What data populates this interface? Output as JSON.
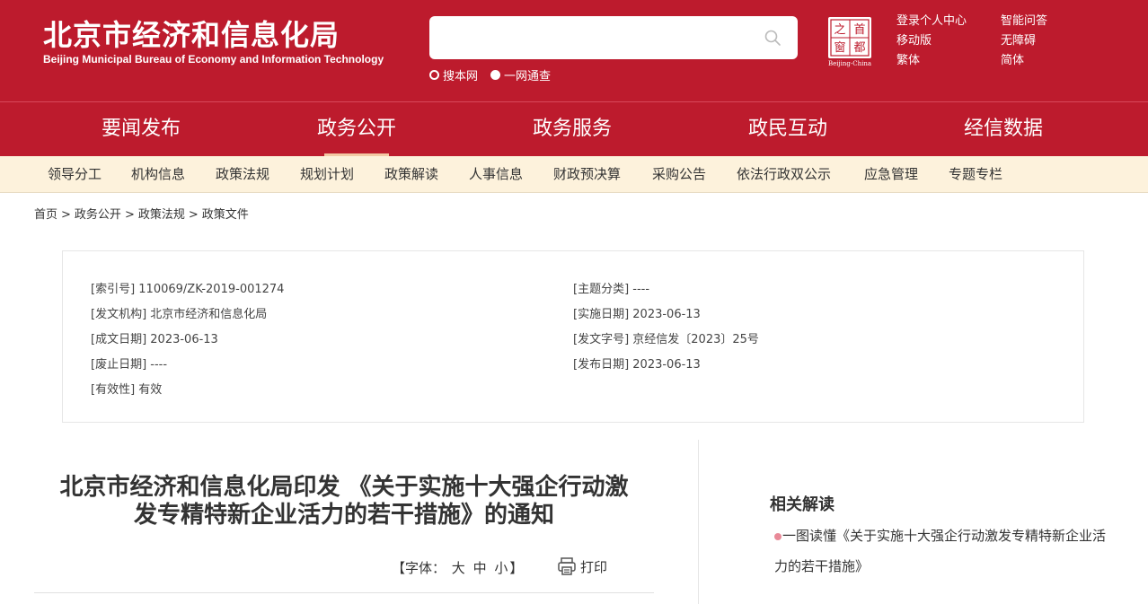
{
  "header": {
    "title_cn": "北京市经济和信息化局",
    "title_en": "Beijing Municipal Bureau of Economy and Information Technology",
    "search_placeholder": "",
    "search_scope": [
      "搜本网",
      "一网通查"
    ],
    "capital_logo_chars": [
      "之",
      "首",
      "窗",
      "都"
    ],
    "capital_logo_caption": "Beijing-China",
    "links": [
      "登录个人中心",
      "智能问答",
      "移动版",
      "无障碍",
      "繁体",
      "简体"
    ]
  },
  "mainnav": [
    "要闻发布",
    "政务公开",
    "政务服务",
    "政民互动",
    "经信数据"
  ],
  "subnav": [
    "领导分工",
    "机构信息",
    "政策法规",
    "规划计划",
    "政策解读",
    "人事信息",
    "财政预决算",
    "采购公告",
    "依法行政双公示",
    "应急管理",
    "专题专栏"
  ],
  "breadcrumb": [
    "首页",
    "政务公开",
    "政策法规",
    "政策文件"
  ],
  "breadcrumb_sep": ">",
  "info": {
    "left": [
      "[索引号] 110069/ZK-2019-001274",
      "[发文机构] 北京市经济和信息化局",
      "[成文日期] 2023-06-13",
      "[废止日期] ----",
      "[有效性] 有效"
    ],
    "right": [
      "[主题分类] ----",
      "[实施日期] 2023-06-13",
      "[发文字号] 京经信发〔2023〕25号",
      "[发布日期] 2023-06-13"
    ]
  },
  "article": {
    "title_line1": "北京市经济和信息化局印发 《关于实施十大强企行动激",
    "title_line2": "发专精特新企业活力的若干措施》的通知",
    "font_open": "【字体：",
    "font_sizes": [
      "大",
      "中",
      "小"
    ],
    "font_close": "】",
    "print": "打印"
  },
  "related": {
    "title": "相关解读",
    "items": [
      "一图读懂《关于实施十大强企行动激发专精特新企业活力的若干措施》"
    ]
  },
  "colors": {
    "brand_red": "#bd1b2d",
    "subnav_bg": "#fdf2dc",
    "active_underline": "#f3c9a4"
  }
}
